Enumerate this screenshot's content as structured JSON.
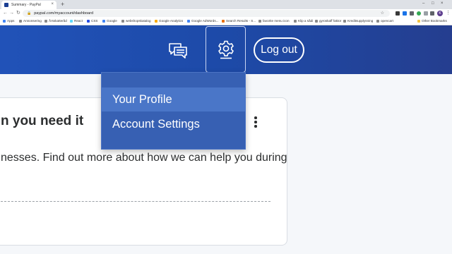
{
  "browser": {
    "tab_title": "Summary - PayPal",
    "tab_close": "×",
    "new_tab": "+",
    "window_controls": [
      "–",
      "□",
      "×"
    ],
    "nav": {
      "back": "←",
      "forward": "→",
      "reload": "↻"
    },
    "url": "paypal.com/myaccount/dashboard",
    "lock": "🔒",
    "star": "☆",
    "profile_initial": "K",
    "menu": "⋮",
    "bookmarks": [
      "Apps",
      "Annonsering",
      "Årsskatteråd",
      "React",
      "CSS",
      "Google",
      "webshopskatalog",
      "Google Analytics",
      "Google AdWords...",
      "Search Results - S...",
      "favorite menu icon",
      "Klip a sådi",
      "gyroskaff faktor",
      "Kreditsupplysning",
      "opencart"
    ],
    "other_bookmarks": "Other Bookmarks",
    "colors": {
      "brand": "#1b3f92"
    }
  },
  "header": {
    "messages_icon": "chat-bubbles-icon",
    "settings_icon": "gear-icon",
    "logout_label": "Log out",
    "colors": {
      "background": "#2152b8",
      "accent": "#253e8f"
    }
  },
  "settings_menu": {
    "items": [
      {
        "label": "Your Profile",
        "active": true
      },
      {
        "label": "Account Settings",
        "active": false
      }
    ],
    "colors": {
      "background": "#3760b3",
      "hover": "#4a76c8"
    }
  },
  "card": {
    "title": "n you need it",
    "text": "nesses. Find out more about how we can help you during",
    "more_icon": "vertical-ellipsis-icon"
  }
}
